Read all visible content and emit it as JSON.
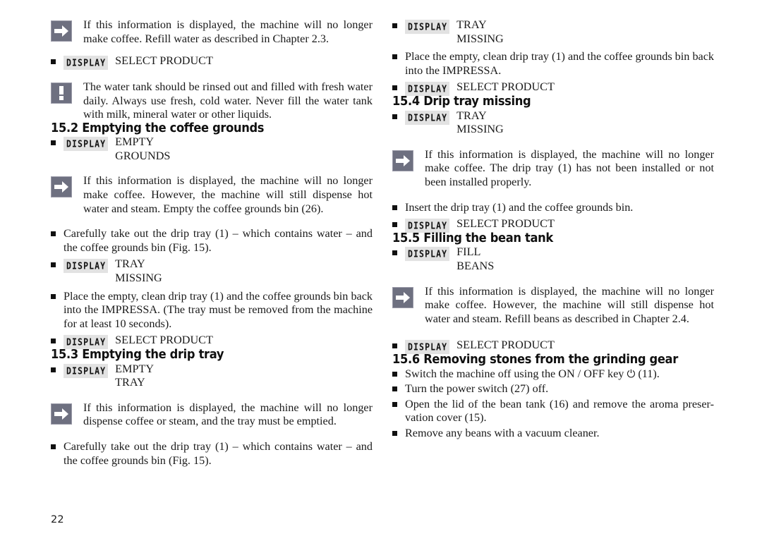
{
  "page": {
    "number": "22",
    "display_badge_label": "DISPLAY",
    "icons": {
      "arrow": "arrow-right-icon",
      "warning": "exclamation-icon",
      "bullet": "square-bullet-icon",
      "power": "power-symbol-icon"
    },
    "colors": {
      "icon_fill": "#6e7080",
      "icon_border": "#9a9aa8",
      "icon_glyph": "#ffffff",
      "badge_bg": "#e2e2e2",
      "text": "#1a1a1a"
    }
  },
  "left_column": {
    "note_water": {
      "icon": "arrow-right-icon",
      "line1": "If this information is displayed, the machine will no longer",
      "line2": "make coffee. Refill water as described in Chapter 2.3."
    },
    "display_select_product_1": {
      "badge": "DISPLAY",
      "value": "SELECT PRODUCT"
    },
    "note_tank": {
      "icon": "exclamation-icon",
      "line1": "The water tank should be rinsed out and filled with fresh",
      "line2": "water daily. Always use fresh, cold water. Never fill the",
      "line3": "water tank with milk, mineral water or other liquids."
    },
    "heading_15_2": "15.2 Emptying the coffee grounds",
    "display_empty_grounds": {
      "badge": "DISPLAY",
      "line1": "EMPTY",
      "line2": "GROUNDS"
    },
    "note_grounds": {
      "icon": "arrow-right-icon",
      "line1": "If this information is displayed, the machine will no longer",
      "line2": "make coffee. However, the machine will still dispense hot",
      "line3": "water and steam. Empty the coffee grounds bin (26)."
    },
    "bullet_take_out_tray_1": {
      "line1": "Carefully take out the drip tray (1) – which contains water – and",
      "line2": "the coffee grounds bin (Fig. 15)."
    },
    "display_tray_missing_1": {
      "badge": "DISPLAY",
      "line1": "TRAY",
      "line2": "MISSING"
    },
    "bullet_place_back_1": {
      "line1": "Place the empty, clean drip tray (1) and the coffee grounds bin",
      "line2": "back into the IMPRESSA. (The tray must be removed from the",
      "line3": "machine for at least 10 seconds)."
    },
    "display_select_product_2": {
      "badge": "DISPLAY",
      "value": "SELECT PRODUCT"
    },
    "heading_15_3": "15.3 Emptying the drip tray",
    "display_empty_tray": {
      "badge": "DISPLAY",
      "line1": "EMPTY",
      "line2": "TRAY"
    },
    "note_drip": {
      "icon": "arrow-right-icon",
      "line1": "If this information is displayed, the machine will no longer",
      "line2": "dispense coffee or steam, and the tray must be emptied."
    },
    "bullet_take_out_tray_2": {
      "line1": "Carefully take out the drip tray (1) – which contains water – and",
      "line2": "the coffee grounds bin (Fig. 15)."
    }
  },
  "right_column": {
    "display_tray_missing_2": {
      "badge": "DISPLAY",
      "line1": "TRAY",
      "line2": "MISSING"
    },
    "bullet_place_back_2": {
      "line1": "Place the empty, clean drip tray (1) and the coffee grounds bin",
      "line2": "back into the IMPRESSA."
    },
    "display_select_product_3": {
      "badge": "DISPLAY",
      "value": "SELECT PRODUCT"
    },
    "heading_15_4": "15.4 Drip tray missing",
    "display_tray_missing_3": {
      "badge": "DISPLAY",
      "line1": "TRAY",
      "line2": "MISSING"
    },
    "note_tray_missing": {
      "icon": "arrow-right-icon",
      "line1": "If this information is displayed, the machine will no longer",
      "line2": "make coffee. The drip tray (1) has not been installed or not",
      "line3": "been installed properly."
    },
    "bullet_insert_tray": {
      "line1": "Insert the drip tray (1) and the coffee grounds bin."
    },
    "display_select_product_4": {
      "badge": "DISPLAY",
      "value": "SELECT PRODUCT"
    },
    "heading_15_5": "15.5 Filling the bean tank",
    "display_fill_beans": {
      "badge": "DISPLAY",
      "line1": "FILL",
      "line2": "BEANS"
    },
    "note_beans": {
      "icon": "arrow-right-icon",
      "line1": "If this information is displayed, the machine will no longer",
      "line2": "make coffee. However, the machine will still dispense hot",
      "line3": "water and steam. Refill beans as described in Chapter 2.4."
    },
    "display_select_product_5": {
      "badge": "DISPLAY",
      "value": "SELECT PRODUCT"
    },
    "heading_15_6": "15.6 Removing stones from the grinding gear",
    "bullet_switch_off_a": "Switch the machine off using the ON / OFF key ",
    "bullet_switch_off_b": " (11).",
    "bullet_power_switch": "Turn the power switch (27) off.",
    "bullet_open_lid": {
      "line1": "Open the lid of the bean tank (16) and remove the aroma preser-",
      "line2": "vation cover (15)."
    },
    "bullet_vacuum": "Remove any beans with a vacuum cleaner."
  }
}
